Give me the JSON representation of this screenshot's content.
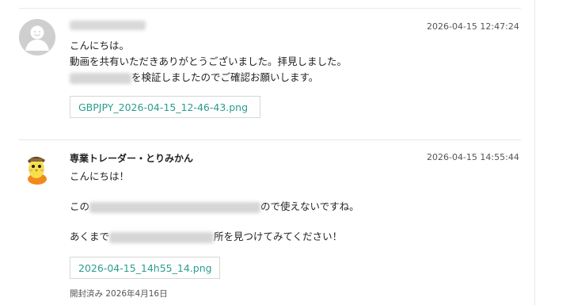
{
  "messages": [
    {
      "author": "",
      "time": "2026-04-15 12:47:24",
      "lines": [
        {
          "text": "こんにちは。"
        },
        {
          "text": "動画を共有いただきありがとうございました。拝見しました。"
        },
        {
          "pre": "",
          "post": "を検証しましたのでご確認お願いします。"
        }
      ],
      "attachment": "GBPJPY_2026-04-15_12-46-43.png"
    },
    {
      "author": "専業トレーダー・とりみかん",
      "time": "2026-04-15 14:55:44",
      "lines": [
        {
          "text": "こんにちは！"
        },
        {
          "pre": "この",
          "post": "ので使えないですね。"
        },
        {
          "pre": "あくまで",
          "post": "所を見つけてみてください！"
        }
      ],
      "attachment": "2026-04-15_14h55_14.png",
      "status": "開封済み 2026年4月16日"
    }
  ],
  "icons": {
    "default_avatar": "user-silhouette-icon",
    "mascot_avatar": "chick-mascot-icon"
  },
  "colors": {
    "link": "#2a9d8f",
    "divider": "#e9e9e9",
    "avatar_bg": "#cfcfcf"
  }
}
